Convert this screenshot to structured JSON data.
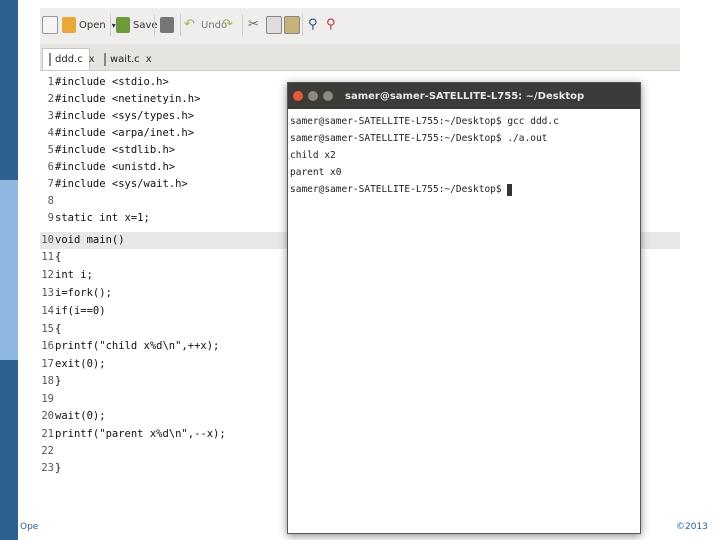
{
  "toolbar": {
    "open_label": "Open",
    "save_label": "Save",
    "undo_label": "Undo"
  },
  "tabs": [
    {
      "label": "ddd.c",
      "close": "x"
    },
    {
      "label": "wait.c",
      "close": "x"
    }
  ],
  "code_lines": [
    {
      "num": "1",
      "text": "#include <stdio.h>"
    },
    {
      "num": "2",
      "text": "#include <netinetyin.h>"
    },
    {
      "num": "3",
      "text": "#include <sys/types.h>"
    },
    {
      "num": "4",
      "text": "#include <arpa/inet.h>"
    },
    {
      "num": "5",
      "text": "#include <stdlib.h>"
    },
    {
      "num": "6",
      "text": "#include <unistd.h>"
    },
    {
      "num": "7",
      "text": "#include <sys/wait.h>"
    },
    {
      "num": "8",
      "text": ""
    },
    {
      "num": "9",
      "text": "static int x=1;"
    },
    {
      "num": "10",
      "text": "void main()"
    },
    {
      "num": "11",
      "text": "{"
    },
    {
      "num": "12",
      "text": "int i;"
    },
    {
      "num": "13",
      "text": "i=fork();"
    },
    {
      "num": "14",
      "text": "if(i==0)"
    },
    {
      "num": "15",
      "text": "{"
    },
    {
      "num": "16",
      "text": "printf(\"child x%d\\n\",++x);"
    },
    {
      "num": "17",
      "text": "exit(0);"
    },
    {
      "num": "18",
      "text": "}"
    },
    {
      "num": "19",
      "text": ""
    },
    {
      "num": "20",
      "text": "wait(0);"
    },
    {
      "num": "21",
      "text": "printf(\"parent x%d\\n\",--x);"
    },
    {
      "num": "22",
      "text": ""
    },
    {
      "num": "23",
      "text": "}"
    }
  ],
  "terminal": {
    "title": "samer@samer-SATELLITE-L755: ~/Desktop",
    "lines": [
      "samer@samer-SATELLITE-L755:~/Desktop$ gcc ddd.c",
      "samer@samer-SATELLITE-L755:~/Desktop$ ./a.out",
      "child x2",
      "parent x0",
      "samer@samer-SATELLITE-L755:~/Desktop$ "
    ]
  },
  "footer": {
    "left": "Ope",
    "right": "©2013"
  },
  "colors": {
    "slide_accent": "#2d5f8f",
    "terminal_titlebar": "#3c3b37",
    "close_button": "#e25b32"
  }
}
